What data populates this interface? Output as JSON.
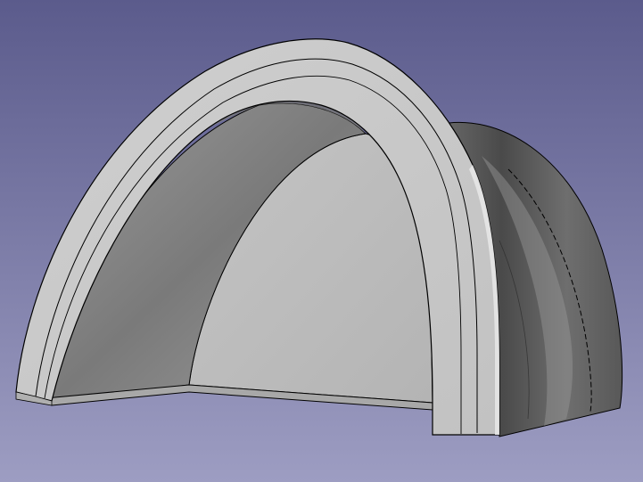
{
  "viewport": {
    "background_top_color": "#5b5b8c",
    "background_bottom_color": "#9d9dc2"
  },
  "model": {
    "shape": "half-dome shell with thickened arch rim",
    "face_color": "#c8c8c8",
    "edge_color": "#000000"
  }
}
